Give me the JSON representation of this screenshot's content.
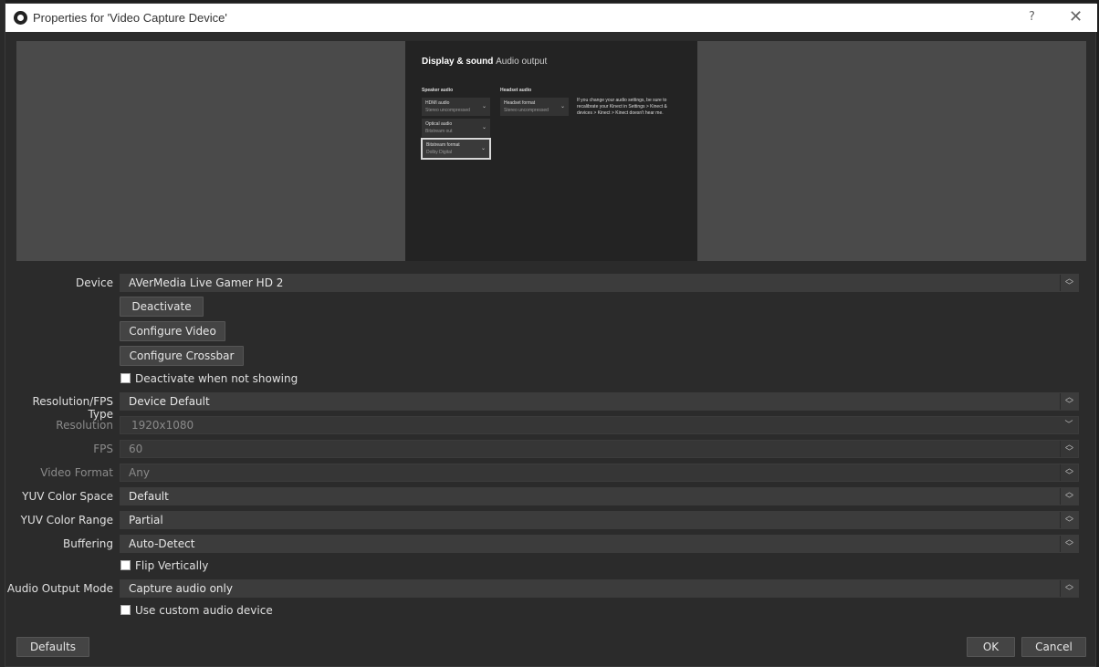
{
  "window": {
    "title": "Properties for 'Video Capture Device'",
    "help_label": "?",
    "close_label": "✕"
  },
  "preview": {
    "heading": "Display & sound",
    "subheading": "Audio output",
    "speaker_title": "Speaker audio",
    "headset_title": "Headset audio",
    "options": [
      {
        "label": "HDMI audio",
        "value": "Stereo uncompressed"
      },
      {
        "label": "Optical audio",
        "value": "Bitstream out"
      },
      {
        "label": "Bitstream format",
        "value": "Dolby Digital"
      },
      {
        "label": "Headset format",
        "value": "Stereo uncompressed"
      }
    ],
    "note": "If you change your audio settings, be sure to recalibrate your Kinect in Settings > Kinect & devices > Kinect > Kinect doesn't hear me."
  },
  "form": {
    "device_label": "Device",
    "device_value": "AVerMedia Live Gamer HD 2",
    "deactivate_button": "Deactivate",
    "configure_video_button": "Configure Video",
    "configure_crossbar_button": "Configure Crossbar",
    "deactivate_when_not_showing": "Deactivate when not showing",
    "resolution_fps_type_label": "Resolution/FPS Type",
    "resolution_fps_type_value": "Device Default",
    "resolution_label": "Resolution",
    "resolution_value": "1920x1080",
    "fps_label": "FPS",
    "fps_value": "60",
    "video_format_label": "Video Format",
    "video_format_value": "Any",
    "yuv_color_space_label": "YUV Color Space",
    "yuv_color_space_value": "Default",
    "yuv_color_range_label": "YUV Color Range",
    "yuv_color_range_value": "Partial",
    "buffering_label": "Buffering",
    "buffering_value": "Auto-Detect",
    "flip_vertically": "Flip Vertically",
    "audio_output_mode_label": "Audio Output Mode",
    "audio_output_mode_value": "Capture audio only",
    "use_custom_audio_device": "Use custom audio device"
  },
  "footer": {
    "defaults_button": "Defaults",
    "ok_button": "OK",
    "cancel_button": "Cancel"
  },
  "icons": {
    "spin": "up-down-arrows-icon",
    "dropdown": "chevron-down-icon",
    "obs_logo": "obs-logo-icon"
  },
  "colors": {
    "background": "#2b2b2b",
    "field": "#3c3c3c",
    "button": "#444444",
    "titlebar": "#ffffff"
  }
}
